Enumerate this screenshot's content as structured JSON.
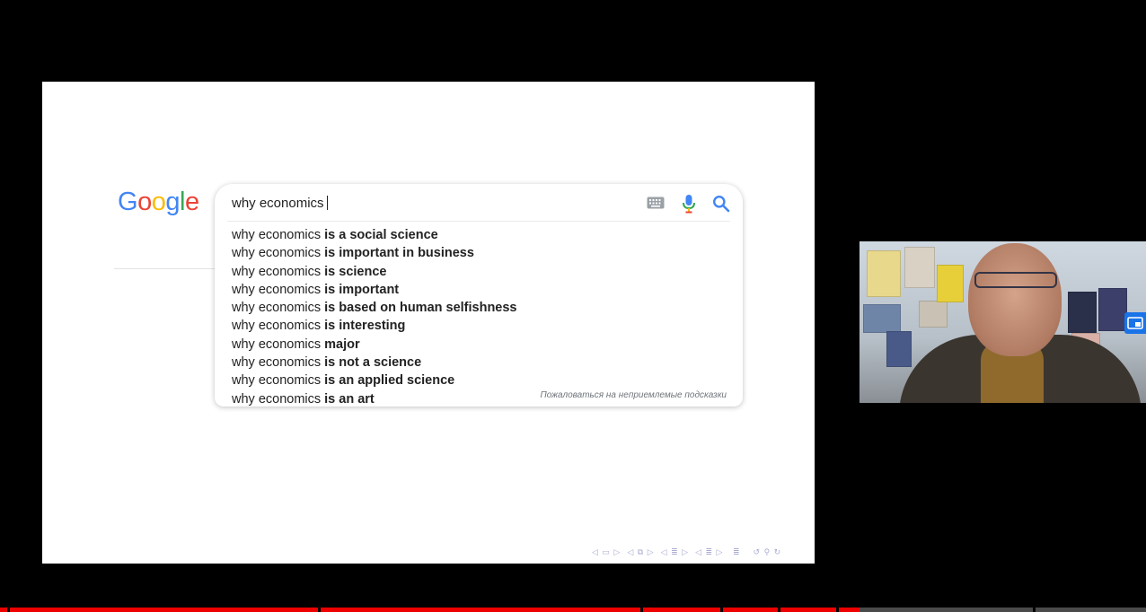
{
  "logo": {
    "letters": [
      "G",
      "o",
      "o",
      "g",
      "l",
      "e"
    ],
    "colors": [
      "#4285F4",
      "#EA4335",
      "#FBBC05",
      "#4285F4",
      "#34A853",
      "#EA4335"
    ]
  },
  "search": {
    "query": "why economics",
    "suggestions": [
      {
        "prefix": "why economics",
        "completion": "is a social science"
      },
      {
        "prefix": "why economics",
        "completion": "is important in business"
      },
      {
        "prefix": "why economics",
        "completion": "is science"
      },
      {
        "prefix": "why economics",
        "completion": "is important"
      },
      {
        "prefix": "why economics",
        "completion": "is based on human selfishness"
      },
      {
        "prefix": "why economics",
        "completion": "is interesting"
      },
      {
        "prefix": "why economics",
        "completion": "major"
      },
      {
        "prefix": "why economics",
        "completion": "is not a science"
      },
      {
        "prefix": "why economics",
        "completion": "is an applied science"
      },
      {
        "prefix": "why economics",
        "completion": "is an art"
      }
    ],
    "report_link": "Пожаловаться на неприемлемые подсказки"
  },
  "icons": {
    "keyboard": "keyboard-icon",
    "mic": "microphone-icon",
    "search": "search-icon",
    "pip": "picture-in-picture-icon"
  },
  "colors": {
    "progress_played": "#ee0000",
    "progress_track": "#4a4a4a",
    "pip_accent": "#1a73e8"
  },
  "video": {
    "progress_fraction": 0.75
  }
}
